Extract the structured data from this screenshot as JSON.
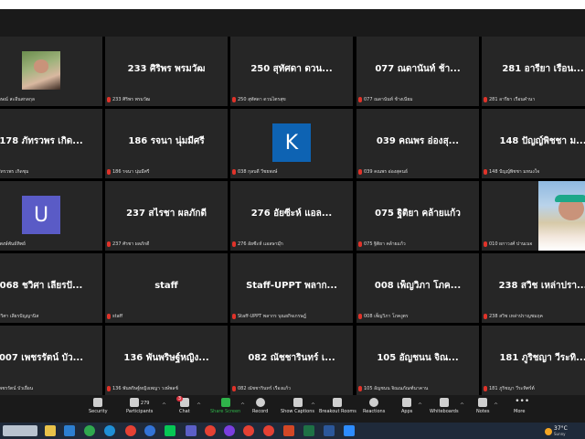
{
  "colors": {
    "tile_bg": "#262626",
    "toolbar_bg": "#1a1a1a",
    "share_green": "#2fb34a",
    "badge_red": "#d8323e",
    "avatar_blue": "#0e63b3",
    "avatar_purple": "#5a5bc6"
  },
  "tiles": [
    {
      "title": "",
      "label": "ศาภัสรษณ์ สะอีนสกลกุล",
      "photo": true
    },
    {
      "title": "233 ศิริพร พรมวัฒ",
      "label": "233 ศิริพร พรมวัฒ"
    },
    {
      "title": "250 สุทัศดา ดวน...",
      "label": "250 สุทัศดา ดวนไตรสุข"
    },
    {
      "title": "077 ณดานันท์ ช้า...",
      "label": "077 ณดานันท์ ช้างเนียม"
    },
    {
      "title": "281 อารียา เรือน...",
      "label": "281 อารียา เรือนคำนา"
    },
    {
      "title": "178 ภัทรวพร เกิด...",
      "label": "178 ภัทรวพร เกิดชุม"
    },
    {
      "title": "186 รจนา นุ่มมีศรี",
      "label": "186 รจนา นุ่มมีศรี"
    },
    {
      "title": "",
      "label": "038 กุลบดี วีชยพงษ์",
      "avatar": "K",
      "avatar_color": "blue"
    },
    {
      "title": "039 คณพร อ่องสุ...",
      "label": "039 คณพร อ่องสุคนธ์"
    },
    {
      "title": "148 ปัญญ์พิชชา ม...",
      "label": "148 ปัญญ์พิชชา มหนงใจ"
    },
    {
      "title": "",
      "label": "ปราพ พงษ์พันธ์ทิพย์",
      "avatar": "U",
      "avatar_color": "purple"
    },
    {
      "title": "237 สไรชา ผลภักดี",
      "label": "237 ศัรชา ผลภักดี"
    },
    {
      "title": "276 อัยซีะห์  แอล...",
      "label": "276 อัยซีะห์ แอลษามุ๊ก"
    },
    {
      "title": "075 ฐิติยา คล้ายแก้ว",
      "label": "075 ฐิติยา คล้ายแก้ว"
    },
    {
      "title": "",
      "label": "010 ผกาวงศ์ ปานเนจ",
      "photo_large": true
    },
    {
      "title": "068 ชวิศา เลียรปั...",
      "label": "068 ชวิศา เลียรปัญญานิส"
    },
    {
      "title": "staff",
      "label": "staff"
    },
    {
      "title": "Staff-UPPT พลาก...",
      "label": "Staff-UPPT พลากร บุณยกิจเกรษฎ์"
    },
    {
      "title": "008 เพ็ญวิภา โภค...",
      "label": "008 เพ็ญวิภา โภคงูตร"
    },
    {
      "title": "238 สวิช เหล่าปรา...",
      "label": "238 สวิช เหล่าปราญชมฤค"
    },
    {
      "title": "007 เพชรรัตน์ บัว...",
      "label": "007 เพชรรัตน์ บัวเยื่อน"
    },
    {
      "title": "136 พันพริษฐ์หญิง...",
      "label": "136 พันพริษฐ์หญิงเพญา วงษ์พลช์"
    },
    {
      "title": "082 ณัชชารินทร์ เ...",
      "label": "082 ณัชชารินทร์ เรืองแก้ว"
    },
    {
      "title": "105 อัญชนน จิณ...",
      "label": "105 อัญชนน จิณณภัณฑ์นาคาน"
    },
    {
      "title": "181 ภูริชญา วีระทิ...",
      "label": "181 ภูริชญา วีระทิศร์ต์"
    }
  ],
  "toolbar": {
    "security": "Security",
    "participants": "Participants",
    "participants_count": "279",
    "chat": "Chat",
    "chat_badge": "3",
    "share": "Share Screen",
    "record": "Record",
    "captions": "Show Captions",
    "breakout": "Breakout Rooms",
    "reactions": "Reactions",
    "apps": "Apps",
    "whiteboards": "Whiteboards",
    "notes": "Notes",
    "more": "More"
  },
  "taskbar": {
    "temperature": "37°C",
    "weather_desc": "Sunny"
  }
}
